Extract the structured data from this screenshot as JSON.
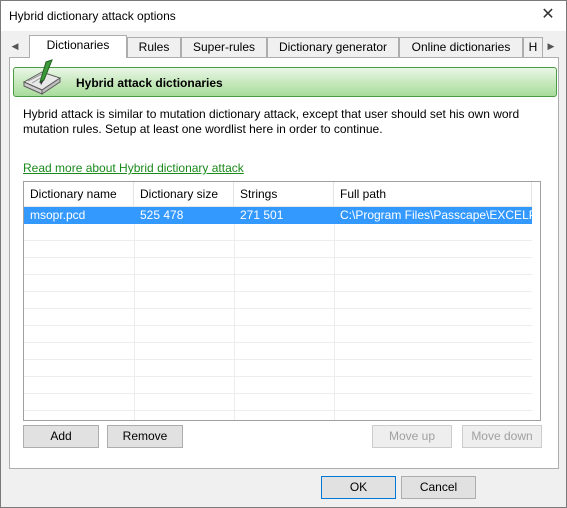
{
  "window": {
    "title": "Hybrid dictionary attack options",
    "close_glyph": "✕"
  },
  "tabs": {
    "scroll_left": "◀",
    "scroll_right": "▶",
    "items": [
      {
        "label": "Dictionaries",
        "active": true
      },
      {
        "label": "Rules"
      },
      {
        "label": "Super-rules"
      },
      {
        "label": "Dictionary generator"
      },
      {
        "label": "Online dictionaries"
      },
      {
        "label": "H"
      }
    ]
  },
  "banner": {
    "title": "Hybrid attack dictionaries",
    "icon": "book-pen-icon"
  },
  "description": "Hybrid attack is similar to mutation dictionary attack, except that user should set his own word mutation rules. Setup at least one wordlist here in order to continue.",
  "read_more_link": "Read more about Hybrid dictionary attack",
  "table": {
    "columns": [
      "Dictionary name",
      "Dictionary size",
      "Strings",
      "Full path"
    ],
    "rows": [
      [
        "msopr.pcd",
        "525 478",
        "271 501",
        "C:\\Program Files\\Passcape\\EXCELPR..."
      ]
    ]
  },
  "buttons": {
    "add": "Add",
    "remove": "Remove",
    "move_up": "Move up",
    "move_down": "Move down",
    "ok": "OK",
    "cancel": "Cancel"
  },
  "colors": {
    "selection": "#3399ff",
    "link": "#1a8a1a",
    "banner_border": "#4a9a46"
  }
}
